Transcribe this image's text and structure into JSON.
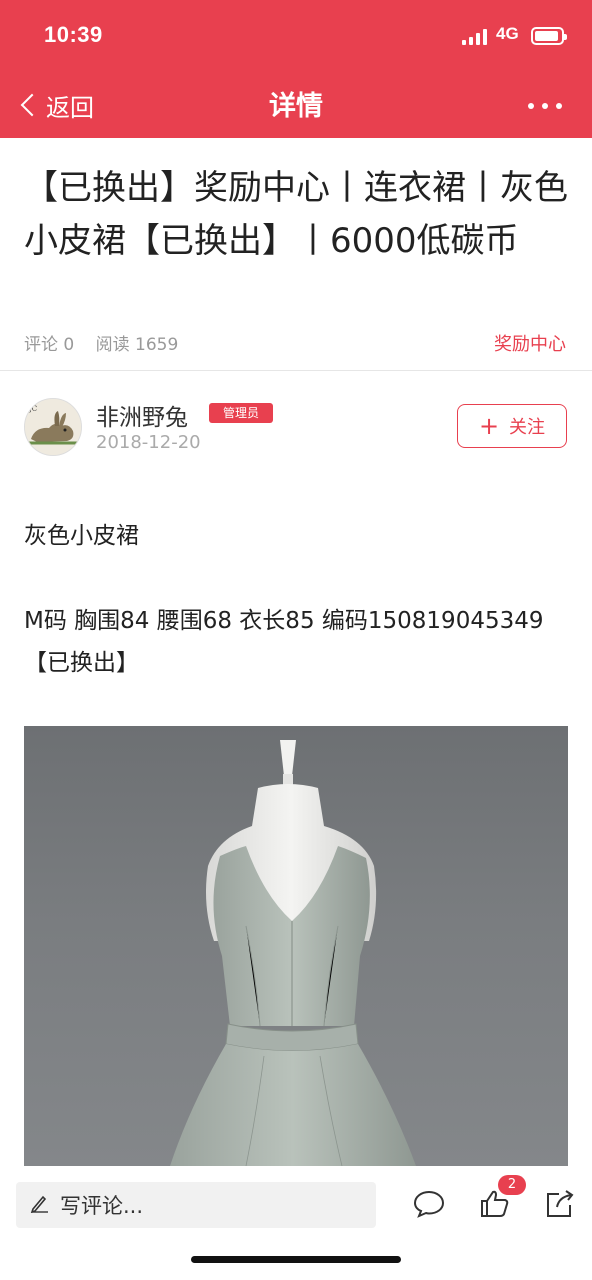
{
  "status_bar": {
    "time": "10:39",
    "network": "4G",
    "battery_level": 0.9
  },
  "nav": {
    "back_label": "返回",
    "title": "详情"
  },
  "article": {
    "title": "【已换出】奖励中心丨连衣裙丨灰色小皮裙【已换出】丨6000低碳币",
    "comments_label": "评论 0",
    "reads_label": "阅读 1659",
    "category": "奖励中心"
  },
  "author": {
    "name": "非洲野兔",
    "role_badge": "管理员",
    "date": "2018-12-20",
    "follow_label": "关注"
  },
  "content": {
    "paragraph1": "灰色小皮裙",
    "paragraph2": "M码  胸围84  腰围68  衣长85  编码150819045349【已换出】"
  },
  "bottom_bar": {
    "comment_placeholder": "写评论...",
    "like_count": "2",
    "icons": [
      "pen-icon",
      "comment-icon",
      "thumbs-up-icon",
      "share-icon"
    ]
  },
  "colors": {
    "brand": "#e8404f"
  }
}
